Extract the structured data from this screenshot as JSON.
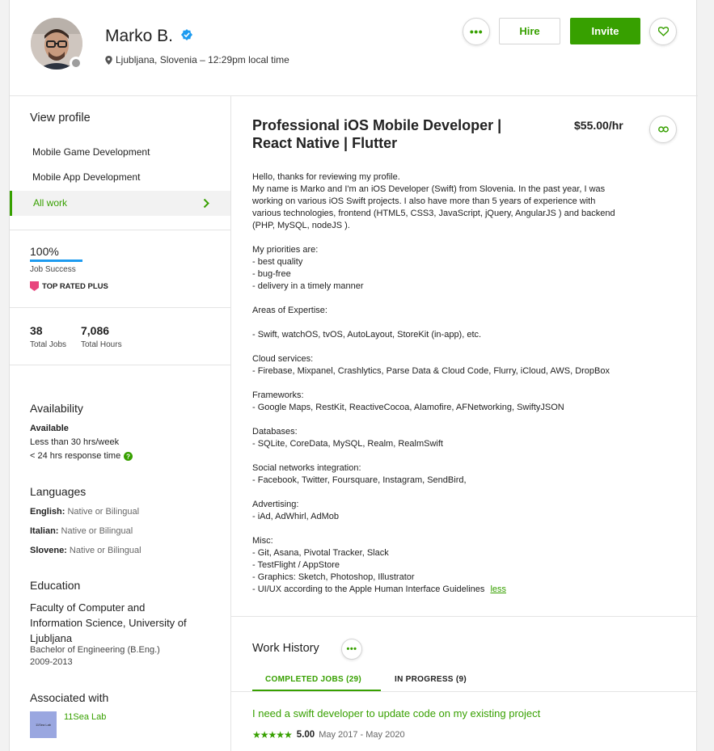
{
  "profile": {
    "name": "Marko B.",
    "location": "Ljubljana, Slovenia – 12:29pm local time"
  },
  "header": {
    "hire_label": "Hire",
    "invite_label": "Invite"
  },
  "sidebar": {
    "view_profile_title": "View profile",
    "items": [
      {
        "label": "Mobile Game Development"
      },
      {
        "label": "Mobile App Development"
      },
      {
        "label": "All work"
      }
    ],
    "job_success_value": "100%",
    "job_success_fraction": 1.0,
    "job_success_label": "Job Success",
    "badge_label": "TOP RATED PLUS",
    "total_jobs_value": "38",
    "total_jobs_label": "Total Jobs",
    "total_hours_value": "7,086",
    "total_hours_label": "Total Hours",
    "availability_title": "Availability",
    "availability_status": "Available",
    "availability_hours": "Less than 30 hrs/week",
    "availability_response": "< 24 hrs response time",
    "languages_title": "Languages",
    "languages": [
      {
        "name": "English:",
        "level": "Native or Bilingual"
      },
      {
        "name": "Italian:",
        "level": "Native or Bilingual"
      },
      {
        "name": "Slovene:",
        "level": "Native or Bilingual"
      }
    ],
    "education_title": "Education",
    "education_school_line1": "Faculty of Computer and",
    "education_school_line2": "Information Science, University of",
    "education_school_line3": "Ljubljana",
    "education_degree": "Bachelor of Engineering (B.Eng.)",
    "education_years": "2009-2013",
    "associated_title": "Associated with",
    "agency_name": "11Sea Lab",
    "agency_logo_text": "11Sea Lab"
  },
  "main": {
    "title_line1": "Professional iOS Mobile Developer |",
    "title_line2": "React Native | Flutter",
    "rate": "$55.00/hr",
    "description_lines": [
      "Hello, thanks for reviewing my profile.",
      "My name is Marko and I'm an iOS Developer (Swift) from Slovenia. In the past year, I was",
      "working on various iOS Swift projects. I also have more than 5 years of experience with",
      "various technologies, frontend (HTML5, CSS3, JavaScript, jQuery, AngularJS ) and backend",
      "(PHP, MySQL, nodeJS ).",
      "",
      "My priorities are:",
      "- best quality",
      "- bug-free",
      "- delivery in a timely manner",
      "",
      "Areas of Expertise:",
      "",
      "- Swift, watchOS, tvOS, AutoLayout, StoreKit (in-app), etc.",
      "",
      "Cloud services:",
      "- Firebase, Mixpanel, Crashlytics, Parse Data & Cloud Code, Flurry, iCloud, AWS, DropBox",
      "",
      "Frameworks:",
      "- Google Maps, RestKit, ReactiveCocoa, Alamofire, AFNetworking, SwiftyJSON",
      "",
      "Databases:",
      "- SQLite, CoreData, MySQL, Realm, RealmSwift",
      "",
      "Social networks integration:",
      "- Facebook, Twitter, Foursquare, Instagram, SendBird,",
      "",
      "Advertising:",
      "- iAd, AdWhirl, AdMob",
      "",
      "Misc:",
      "- Git, Asana, Pivotal Tracker, Slack",
      "- TestFlight / AppStore",
      "- Graphics: Sketch, Photoshop, Illustrator",
      "- UI/UX according to the Apple Human Interface Guidelines"
    ],
    "less_label": "less",
    "work_history_title": "Work History",
    "tabs": [
      {
        "label": "COMPLETED JOBS (29)"
      },
      {
        "label": "IN PROGRESS (9)"
      }
    ],
    "job": {
      "title": "I need a swift developer to update code on my existing project",
      "stars": "★★★★★",
      "rating": "5.00",
      "dates": "May 2017 - May 2020"
    }
  },
  "colors": {
    "accent": "#37a000",
    "verified": "#1d9bf0",
    "badge": "#e8457d",
    "progress": "#1d9bf0"
  },
  "icons": [
    "more-icon",
    "heart-icon",
    "verified-icon",
    "location-pin-icon",
    "link-icon",
    "chevron-right-icon",
    "question-icon",
    "badge-icon"
  ]
}
